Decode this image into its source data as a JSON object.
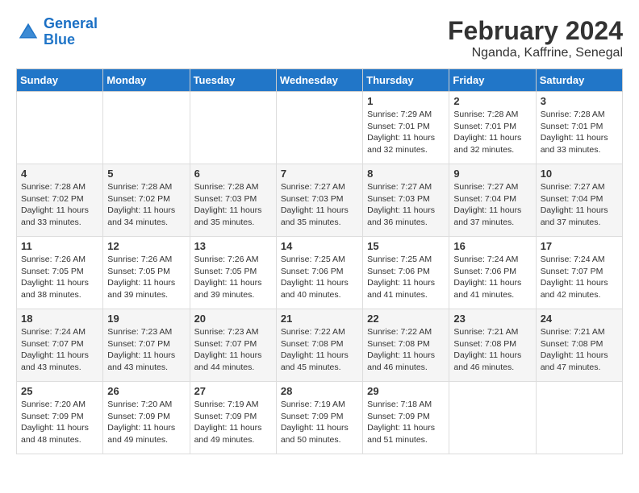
{
  "header": {
    "logo_line1": "General",
    "logo_line2": "Blue",
    "month_year": "February 2024",
    "location": "Nganda, Kaffrine, Senegal"
  },
  "weekdays": [
    "Sunday",
    "Monday",
    "Tuesday",
    "Wednesday",
    "Thursday",
    "Friday",
    "Saturday"
  ],
  "weeks": [
    [
      {
        "day": "",
        "content": ""
      },
      {
        "day": "",
        "content": ""
      },
      {
        "day": "",
        "content": ""
      },
      {
        "day": "",
        "content": ""
      },
      {
        "day": "1",
        "content": "Sunrise: 7:29 AM\nSunset: 7:01 PM\nDaylight: 11 hours\nand 32 minutes."
      },
      {
        "day": "2",
        "content": "Sunrise: 7:28 AM\nSunset: 7:01 PM\nDaylight: 11 hours\nand 32 minutes."
      },
      {
        "day": "3",
        "content": "Sunrise: 7:28 AM\nSunset: 7:01 PM\nDaylight: 11 hours\nand 33 minutes."
      }
    ],
    [
      {
        "day": "4",
        "content": "Sunrise: 7:28 AM\nSunset: 7:02 PM\nDaylight: 11 hours\nand 33 minutes."
      },
      {
        "day": "5",
        "content": "Sunrise: 7:28 AM\nSunset: 7:02 PM\nDaylight: 11 hours\nand 34 minutes."
      },
      {
        "day": "6",
        "content": "Sunrise: 7:28 AM\nSunset: 7:03 PM\nDaylight: 11 hours\nand 35 minutes."
      },
      {
        "day": "7",
        "content": "Sunrise: 7:27 AM\nSunset: 7:03 PM\nDaylight: 11 hours\nand 35 minutes."
      },
      {
        "day": "8",
        "content": "Sunrise: 7:27 AM\nSunset: 7:03 PM\nDaylight: 11 hours\nand 36 minutes."
      },
      {
        "day": "9",
        "content": "Sunrise: 7:27 AM\nSunset: 7:04 PM\nDaylight: 11 hours\nand 37 minutes."
      },
      {
        "day": "10",
        "content": "Sunrise: 7:27 AM\nSunset: 7:04 PM\nDaylight: 11 hours\nand 37 minutes."
      }
    ],
    [
      {
        "day": "11",
        "content": "Sunrise: 7:26 AM\nSunset: 7:05 PM\nDaylight: 11 hours\nand 38 minutes."
      },
      {
        "day": "12",
        "content": "Sunrise: 7:26 AM\nSunset: 7:05 PM\nDaylight: 11 hours\nand 39 minutes."
      },
      {
        "day": "13",
        "content": "Sunrise: 7:26 AM\nSunset: 7:05 PM\nDaylight: 11 hours\nand 39 minutes."
      },
      {
        "day": "14",
        "content": "Sunrise: 7:25 AM\nSunset: 7:06 PM\nDaylight: 11 hours\nand 40 minutes."
      },
      {
        "day": "15",
        "content": "Sunrise: 7:25 AM\nSunset: 7:06 PM\nDaylight: 11 hours\nand 41 minutes."
      },
      {
        "day": "16",
        "content": "Sunrise: 7:24 AM\nSunset: 7:06 PM\nDaylight: 11 hours\nand 41 minutes."
      },
      {
        "day": "17",
        "content": "Sunrise: 7:24 AM\nSunset: 7:07 PM\nDaylight: 11 hours\nand 42 minutes."
      }
    ],
    [
      {
        "day": "18",
        "content": "Sunrise: 7:24 AM\nSunset: 7:07 PM\nDaylight: 11 hours\nand 43 minutes."
      },
      {
        "day": "19",
        "content": "Sunrise: 7:23 AM\nSunset: 7:07 PM\nDaylight: 11 hours\nand 43 minutes."
      },
      {
        "day": "20",
        "content": "Sunrise: 7:23 AM\nSunset: 7:07 PM\nDaylight: 11 hours\nand 44 minutes."
      },
      {
        "day": "21",
        "content": "Sunrise: 7:22 AM\nSunset: 7:08 PM\nDaylight: 11 hours\nand 45 minutes."
      },
      {
        "day": "22",
        "content": "Sunrise: 7:22 AM\nSunset: 7:08 PM\nDaylight: 11 hours\nand 46 minutes."
      },
      {
        "day": "23",
        "content": "Sunrise: 7:21 AM\nSunset: 7:08 PM\nDaylight: 11 hours\nand 46 minutes."
      },
      {
        "day": "24",
        "content": "Sunrise: 7:21 AM\nSunset: 7:08 PM\nDaylight: 11 hours\nand 47 minutes."
      }
    ],
    [
      {
        "day": "25",
        "content": "Sunrise: 7:20 AM\nSunset: 7:09 PM\nDaylight: 11 hours\nand 48 minutes."
      },
      {
        "day": "26",
        "content": "Sunrise: 7:20 AM\nSunset: 7:09 PM\nDaylight: 11 hours\nand 49 minutes."
      },
      {
        "day": "27",
        "content": "Sunrise: 7:19 AM\nSunset: 7:09 PM\nDaylight: 11 hours\nand 49 minutes."
      },
      {
        "day": "28",
        "content": "Sunrise: 7:19 AM\nSunset: 7:09 PM\nDaylight: 11 hours\nand 50 minutes."
      },
      {
        "day": "29",
        "content": "Sunrise: 7:18 AM\nSunset: 7:09 PM\nDaylight: 11 hours\nand 51 minutes."
      },
      {
        "day": "",
        "content": ""
      },
      {
        "day": "",
        "content": ""
      }
    ]
  ]
}
